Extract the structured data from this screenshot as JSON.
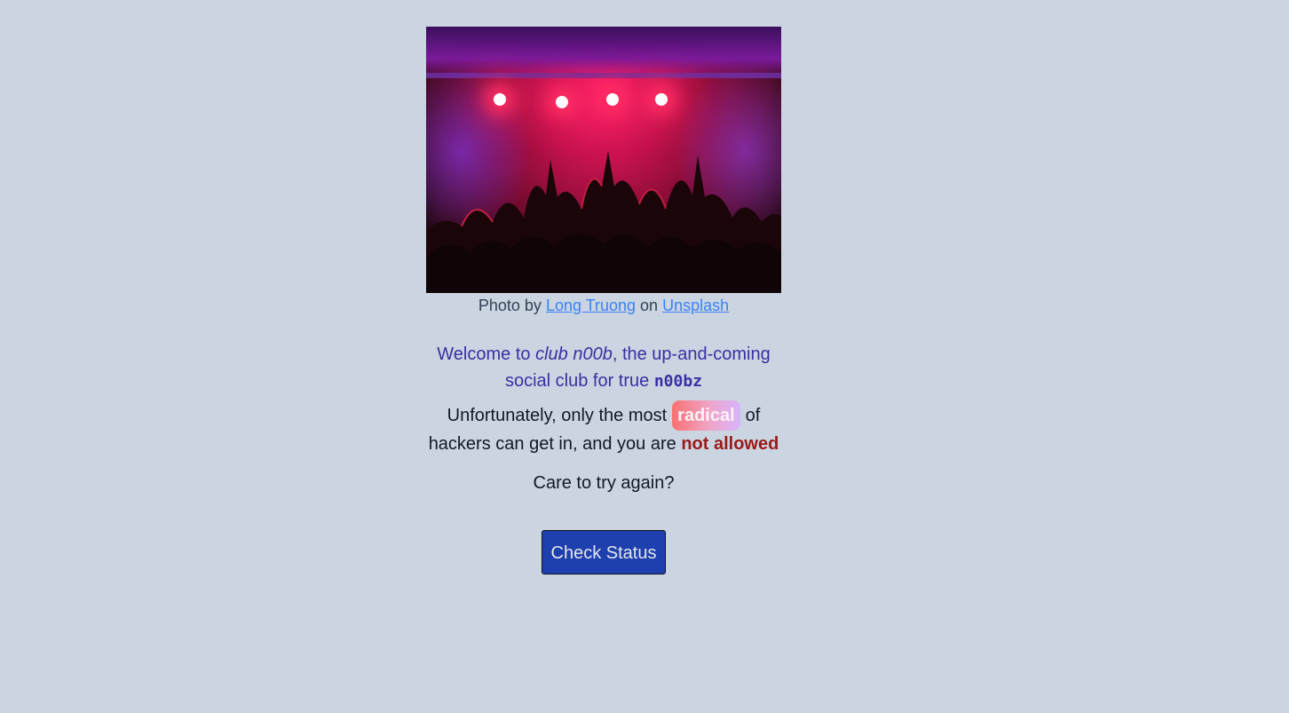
{
  "photo": {
    "alt": "concert crowd with red stage lights"
  },
  "caption": {
    "prefix": "Photo by",
    "author": "Long Truong",
    "middle": "on",
    "site": "Unsplash"
  },
  "welcome": {
    "lead": "Welcome to",
    "club_name": "club n00b",
    "rest": ", the up-and-coming social club for true",
    "code_word": "n00bz"
  },
  "status": {
    "lead": "Unfortunately, only the most",
    "highlight": "radical",
    "middle": "of hackers can get in, and you are",
    "verdict": "not allowed"
  },
  "retry": {
    "text": "Care to try again?"
  },
  "button": {
    "label": "Check Status"
  },
  "colors": {
    "background": "#cbd5e1",
    "link": "#3b82f6",
    "welcome_text": "#3730a3",
    "verdict": "#991b1b",
    "button_bg": "#1e40af"
  }
}
